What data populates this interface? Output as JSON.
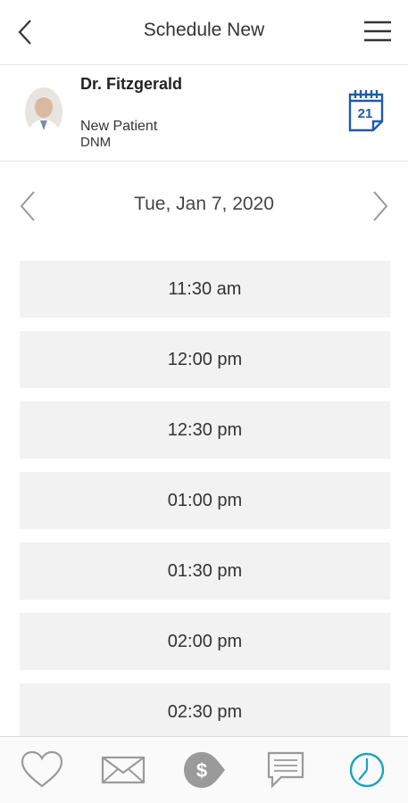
{
  "header": {
    "title": "Schedule New",
    "back_icon": "chevron-left-icon",
    "menu_icon": "hamburger-menu-icon"
  },
  "provider": {
    "name": "Dr. Fitzgerald",
    "visit_type": "New Patient",
    "code": "DNM",
    "calendar_icon": "calendar-icon",
    "calendar_day": "21"
  },
  "date_nav": {
    "date": "Tue, Jan 7, 2020"
  },
  "slots": [
    "11:30 am",
    "12:00 pm",
    "12:30 pm",
    "01:00 pm",
    "01:30 pm",
    "02:00 pm",
    "02:30 pm"
  ],
  "bottom_nav": {
    "items": [
      "heart-icon",
      "mail-icon",
      "dollar-tag-icon",
      "chat-icon",
      "clock-icon"
    ],
    "active_index": 4,
    "active_color": "#1aa3bf",
    "inactive_color": "#9a9a9a"
  },
  "colors": {
    "slot_bg": "#f2f2f2",
    "calendar_blue": "#1e5aa8"
  }
}
